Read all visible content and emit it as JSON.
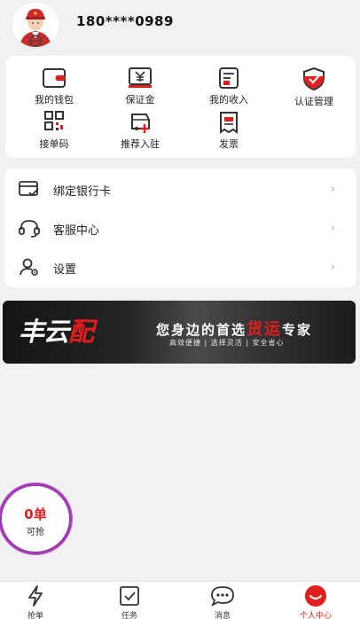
{
  "profile": {
    "phone": "180****0989"
  },
  "grid": [
    {
      "label": "我的钱包",
      "icon": "wallet-icon"
    },
    {
      "label": "保证金",
      "icon": "deposit-yen-icon"
    },
    {
      "label": "我的收入",
      "icon": "income-icon"
    },
    {
      "label": "认证管理",
      "icon": "shield-check-icon"
    },
    {
      "label": "接单码",
      "icon": "qr-code-icon"
    },
    {
      "label": "推荐入驻",
      "icon": "recommend-icon"
    },
    {
      "label": "发票",
      "icon": "invoice-icon"
    }
  ],
  "menu": [
    {
      "label": "绑定银行卡",
      "icon": "bank-card-icon"
    },
    {
      "label": "客服中心",
      "icon": "headset-icon"
    },
    {
      "label": "设置",
      "icon": "user-settings-icon"
    }
  ],
  "banner": {
    "logo_main": "丰云",
    "logo_accent": "配",
    "slogan_pre": "您身边的首选",
    "slogan_highlight": "货运",
    "slogan_post": "专家",
    "tags": "高效便捷 | 选择灵活 | 安全省心"
  },
  "order_button": {
    "count": "0单",
    "label": "可抢"
  },
  "tabs": [
    {
      "label": "抢单",
      "icon": "lightning-icon"
    },
    {
      "label": "任务",
      "icon": "task-check-icon"
    },
    {
      "label": "消息",
      "icon": "message-bubble-icon"
    },
    {
      "label": "个人中心",
      "icon": "profile-active-icon"
    }
  ],
  "colors": {
    "accent": "#e21e1e",
    "background": "#f1f1f3",
    "float_ring": "#9f3ab0"
  }
}
